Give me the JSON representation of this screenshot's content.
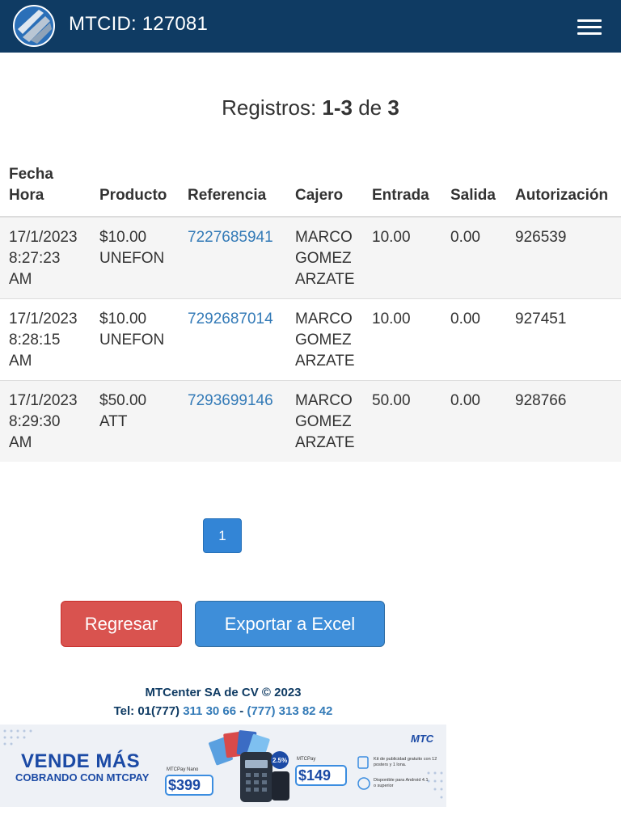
{
  "header": {
    "title": "MTCID: 127081"
  },
  "summary": {
    "prefix": "Registros: ",
    "range": "1-3",
    "of": " de ",
    "total": "3"
  },
  "table": {
    "headers": {
      "fecha": "Fecha\nHora",
      "producto": "Producto",
      "referencia": "Referencia",
      "cajero": "Cajero",
      "entrada": "Entrada",
      "salida": "Salida",
      "autorizacion": "Autorización"
    },
    "rows": [
      {
        "fecha": "17/1/2023\n8:27:23\nAM",
        "producto": "$10.00\nUNEFON",
        "referencia": "7227685941",
        "cajero": "MARCO\nGOMEZ\nARZATE",
        "entrada": "10.00",
        "salida": "0.00",
        "autorizacion": "926539"
      },
      {
        "fecha": "17/1/2023\n8:28:15\nAM",
        "producto": "$10.00\nUNEFON",
        "referencia": "7292687014",
        "cajero": "MARCO\nGOMEZ\nARZATE",
        "entrada": "10.00",
        "salida": "0.00",
        "autorizacion": "927451"
      },
      {
        "fecha": "17/1/2023\n8:29:30\nAM",
        "producto": "$50.00\nATT",
        "referencia": "7293699146",
        "cajero": "MARCO\nGOMEZ\nARZATE",
        "entrada": "50.00",
        "salida": "0.00",
        "autorizacion": "928766"
      }
    ]
  },
  "pagination": {
    "current": "1"
  },
  "actions": {
    "back_label": "Regresar",
    "export_label": "Exportar a Excel"
  },
  "footer": {
    "company": "MTCenter SA de CV © 2023",
    "tel_prefix": "Tel: 01(777) ",
    "phone1": "311 30 66",
    "separator": " - ",
    "phone2": "(777) 313 82 42"
  },
  "banner": {
    "headline": "VENDE MÁS",
    "subline": "COBRANDO CON MTCPAY",
    "brand": "MTC",
    "product1": "MTCPay Nano",
    "price1": "$399",
    "product2": "MTCPay",
    "price2": "$149",
    "badge": "2.5%",
    "feature1": "Kit de publicidad gratuito con 12 posters y 1 lona.",
    "feature2": "Disponible para Android 4.1 o superior"
  },
  "colors": {
    "navbar": "#0f3b63",
    "link": "#337ab7",
    "danger": "#d9534f",
    "primary": "#3e8ed9"
  }
}
